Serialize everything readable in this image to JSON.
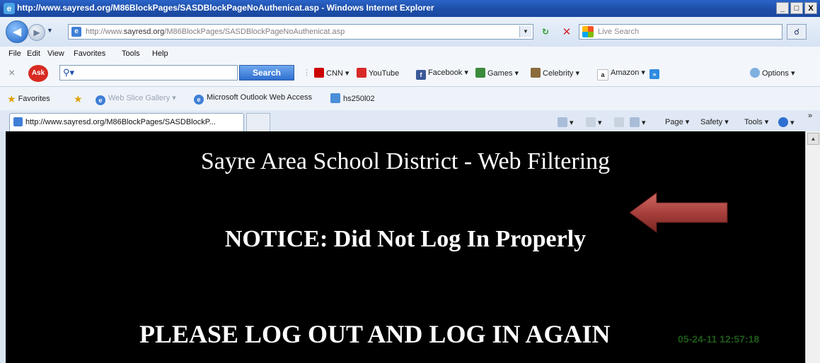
{
  "window": {
    "title": "http://www.sayresd.org/M86BlockPages/SASDBlockPageNoAuthenicat.asp - Windows Internet Explorer",
    "min": "_",
    "max": "□",
    "close": "X"
  },
  "address_bar": {
    "prefix": "http://www.",
    "domain": "sayresd.org",
    "path": "/M86BlockPages/SASDBlockPageNoAuthenicat.asp"
  },
  "live_search": {
    "placeholder": "Live Search"
  },
  "menu": [
    "File",
    "Edit",
    "View",
    "Favorites",
    "Tools",
    "Help"
  ],
  "toolbar": {
    "search_label": "Search",
    "items": [
      "CNN ▾",
      "YouTube",
      "Facebook ▾",
      "Games ▾",
      "Celebrity ▾",
      "Amazon ▾"
    ],
    "options": "Options"
  },
  "favorites": {
    "label": "Favorites",
    "items": [
      "Web Slice Gallery ▾",
      "Microsoft Outlook Web Access",
      "hs250l02"
    ]
  },
  "tab": {
    "title": "http://www.sayresd.org/M86BlockPages/SASDBlockP..."
  },
  "command_bar": [
    "Page ▾",
    "Safety ▾",
    "Tools ▾"
  ],
  "content": {
    "heading": "Sayre Area School District - Web Filtering",
    "notice": "NOTICE: Did Not Log In Properly",
    "instruction": "PLEASE LOG OUT AND LOG IN AGAIN",
    "timestamp": "05-24-11 12:57:18"
  },
  "colors": {
    "page_background": "#000000",
    "page_text": "#ffffff",
    "timestamp": "#1e5a18",
    "arrow": "#a8403c",
    "title_bar": "#1d4ea8"
  }
}
